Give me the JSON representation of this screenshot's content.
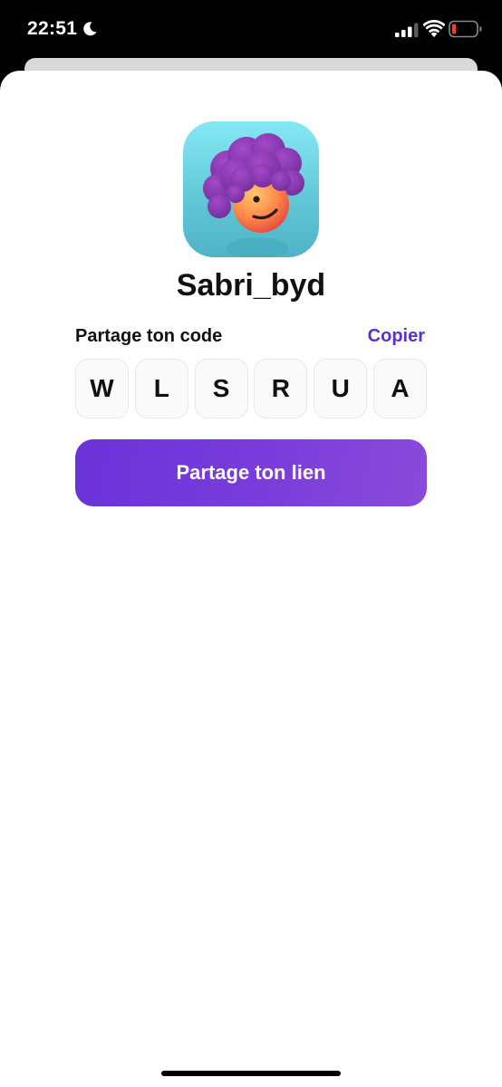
{
  "status_bar": {
    "time": "22:51",
    "icons": [
      "moon-icon",
      "signal-icon",
      "wifi-icon",
      "battery-icon"
    ],
    "battery_color": "#ff3b30"
  },
  "profile": {
    "avatar_icon": "memoji-curly-purple-hair",
    "username": "Sabri_byd"
  },
  "code_section": {
    "label": "Partage ton code",
    "copy_label": "Copier",
    "letters": [
      "W",
      "L",
      "S",
      "R",
      "U",
      "A"
    ]
  },
  "share_button": {
    "label": "Partage ton lien"
  },
  "colors": {
    "accent": "#5b2fd1",
    "button_gradient_start": "#6a32d8",
    "button_gradient_end": "#8a4ad9",
    "avatar_bg": "#6fd6e4"
  }
}
